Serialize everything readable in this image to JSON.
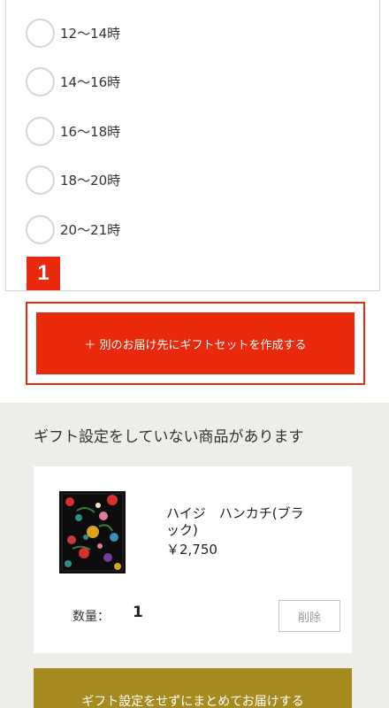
{
  "time_slots": [
    {
      "label": "12〜14時"
    },
    {
      "label": "14〜16時"
    },
    {
      "label": "16〜18時"
    },
    {
      "label": "18〜20時"
    },
    {
      "label": "20〜21時"
    }
  ],
  "step_badge": "1",
  "create_button_label": "＋ 別のお届け先にギフトセットを作成する",
  "gift_section": {
    "title": "ギフト設定をしていない商品があります",
    "product": {
      "name": "ハイジ　ハンカチ(ブラック)",
      "price": "￥2,750",
      "quantity_label": "数量：",
      "quantity": "1",
      "delete_label": "削除"
    },
    "no_gift_button_label": "ギフト設定をせずにまとめてお届けする"
  },
  "colors": {
    "accent_red": "#e8290c",
    "gold": "#a58a1f",
    "section_bg": "#efede9"
  }
}
